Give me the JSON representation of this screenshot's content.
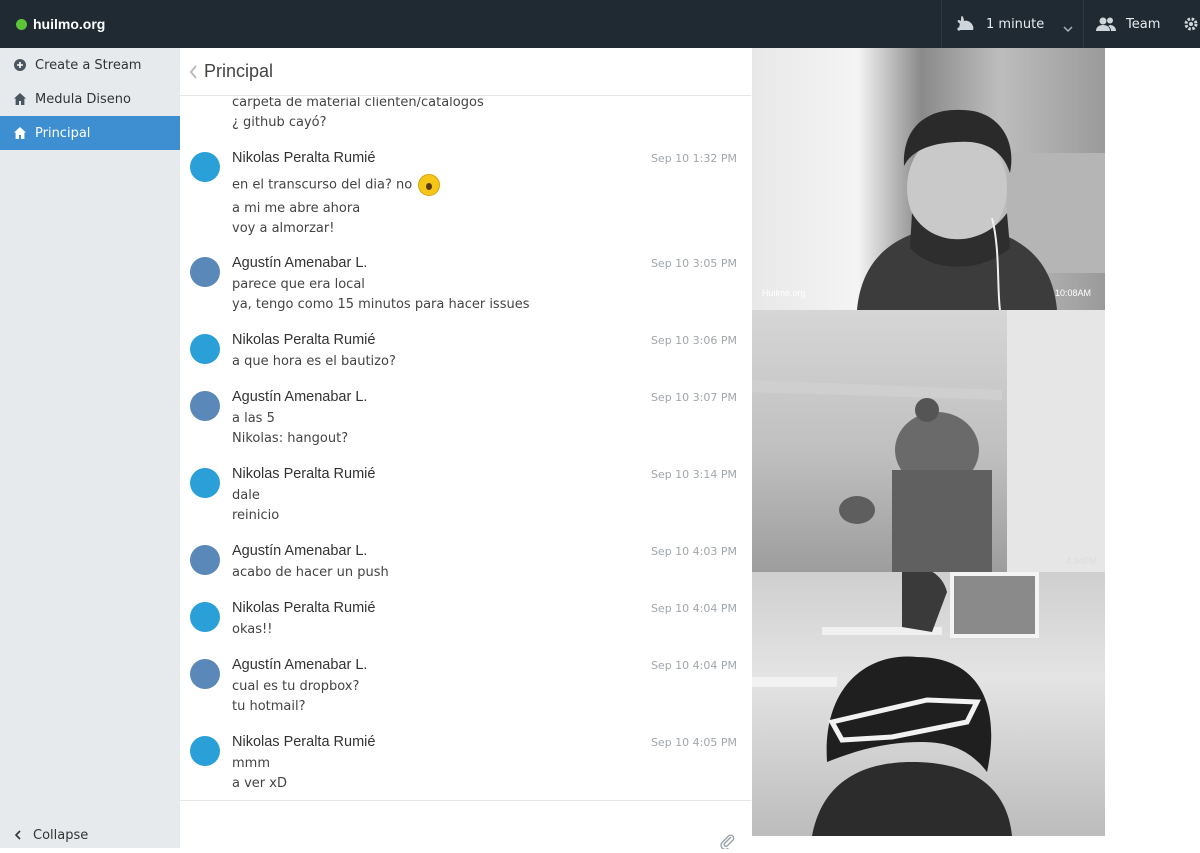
{
  "brand": {
    "name": "huilmo.org",
    "status_color": "#5cc43a"
  },
  "topbar": {
    "time_label": "1 minute",
    "team_label": "Team"
  },
  "sidebar": {
    "items": [
      {
        "label": "Create a Stream",
        "icon": "plus-circle-icon"
      },
      {
        "label": "Medula Diseno",
        "icon": "home-icon"
      },
      {
        "label": "Principal",
        "icon": "home-icon",
        "active": true
      }
    ],
    "collapse_label": "Collapse"
  },
  "chat": {
    "title": "Principal",
    "messages": [
      {
        "lines": [
          "carpeta de material clienten/catalogos",
          "¿ github cayó?"
        ]
      },
      {
        "author": "Nikolas Peralta Rumié",
        "time": "Sep 10 1:32 PM",
        "lines": [
          "en el transcurso del dia? no",
          "a mi me abre ahora",
          "voy a almorzar!"
        ],
        "emoji": "surprised-face-icon"
      },
      {
        "author": "Agustín Amenabar L.",
        "time": "Sep 10 3:05 PM",
        "lines": [
          "parece que era local",
          "ya, tengo como 15 minutos para hacer issues"
        ]
      },
      {
        "author": "Nikolas Peralta Rumié",
        "time": "Sep 10 3:06 PM",
        "lines": [
          "a que hora es el bautizo?"
        ]
      },
      {
        "author": "Agustín Amenabar L.",
        "time": "Sep 10 3:07 PM",
        "lines": [
          "a las 5",
          "Nikolas: hangout?"
        ]
      },
      {
        "author": "Nikolas Peralta Rumié",
        "time": "Sep 10 3:14 PM",
        "lines": [
          "dale",
          "reinicio"
        ]
      },
      {
        "author": "Agustín Amenabar L.",
        "time": "Sep 10 4:03 PM",
        "lines": [
          "acabo de hacer un push"
        ]
      },
      {
        "author": "Nikolas Peralta Rumié",
        "time": "Sep 10 4:04 PM",
        "lines": [
          "okas!!"
        ]
      },
      {
        "author": "Agustín Amenabar L.",
        "time": "Sep 10 4:04 PM",
        "lines": [
          "cual es tu dropbox?",
          "tu hotmail?"
        ]
      },
      {
        "author": "Nikolas Peralta Rumié",
        "time": "Sep 10 4:05 PM",
        "lines": [
          "mmm",
          "a ver xD"
        ]
      }
    ]
  },
  "videos": {
    "feeds": [
      {
        "label": "Huilmo.org",
        "time": "10:08AM"
      },
      {
        "label": "",
        "time": "4:34PM"
      },
      {
        "label": "",
        "time": ""
      }
    ]
  },
  "colors": {
    "topbar": "#1f2a33",
    "sidebar": "#e6eaed",
    "active": "#3d8fd1"
  }
}
